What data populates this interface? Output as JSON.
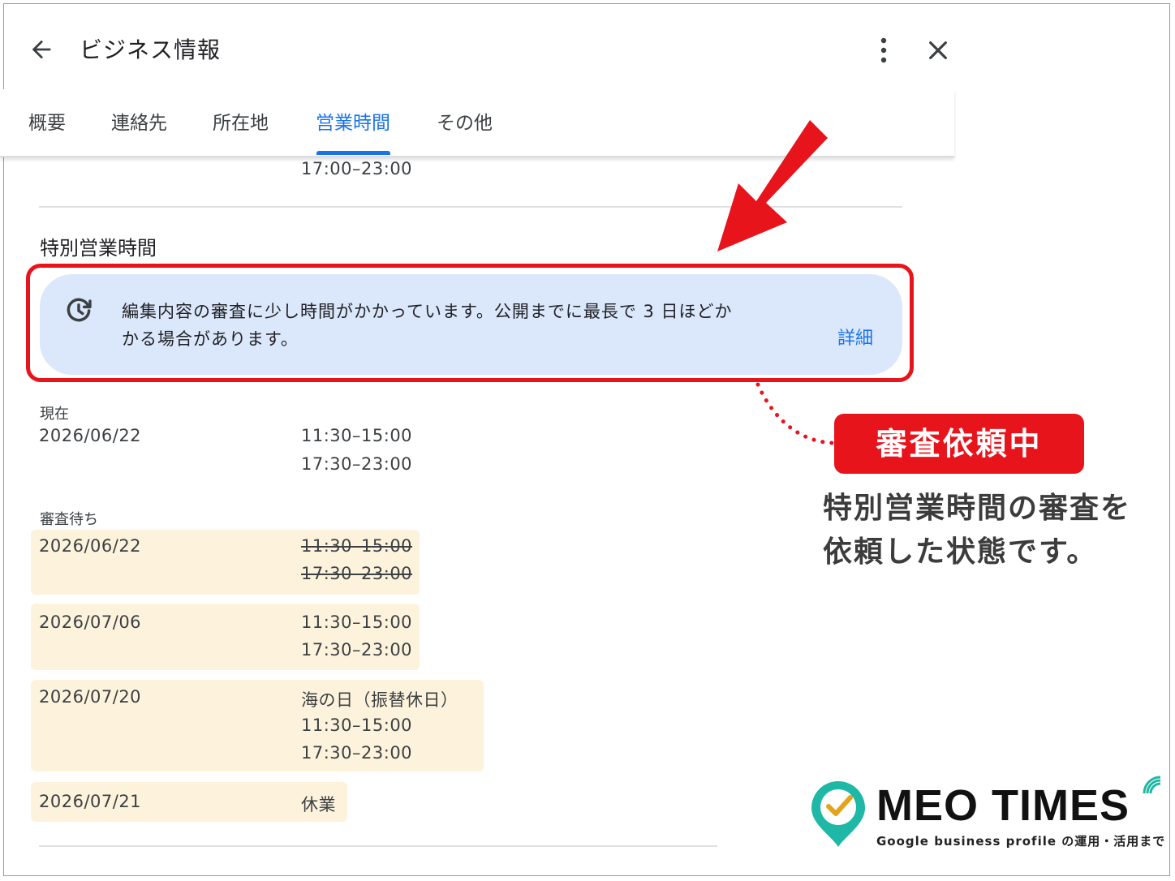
{
  "header": {
    "title": "ビジネス情報"
  },
  "tabs": [
    {
      "label": "概要"
    },
    {
      "label": "連絡先"
    },
    {
      "label": "所在地"
    },
    {
      "label": "営業時間",
      "active": true
    },
    {
      "label": "その他"
    }
  ],
  "regular_hours_tail": "17:00–23:00",
  "special_hours": {
    "title": "特別営業時間",
    "notice": {
      "line1": "編集内容の審査に少し時間がかかっています。公開までに最長で 3 日ほどか",
      "line2": "かる場合があります。",
      "link": "詳細"
    },
    "current": {
      "label": "現在",
      "date": "2026/06/22",
      "hours": [
        "11:30–15:00",
        "17:30–23:00"
      ]
    },
    "pending": {
      "label": "審査待ち",
      "rows": [
        {
          "date": "2026/06/22",
          "lines": [
            "11:30–15:00",
            "17:30–23:00"
          ],
          "struck": true
        },
        {
          "date": "2026/07/06",
          "lines": [
            "11:30–15:00",
            "17:30–23:00"
          ]
        },
        {
          "date": "2026/07/20",
          "lines": [
            "海の日（振替休日）",
            "11:30–15:00",
            "17:30–23:00"
          ]
        },
        {
          "date": "2026/07/21",
          "lines": [
            "休業"
          ]
        }
      ]
    }
  },
  "annotation": {
    "badge": "審査依頼中",
    "line1": "特別営業時間の審査を",
    "line2": "依頼した状態です。"
  },
  "logo": {
    "name": "MEO TIMES",
    "tagline": "Google business profile の運用・活用まで"
  },
  "colors": {
    "accent": "#1a73e8",
    "highlight": "#e8141c",
    "notice_bg": "#dbe7fb",
    "pending_bg": "#fdf3dc"
  }
}
